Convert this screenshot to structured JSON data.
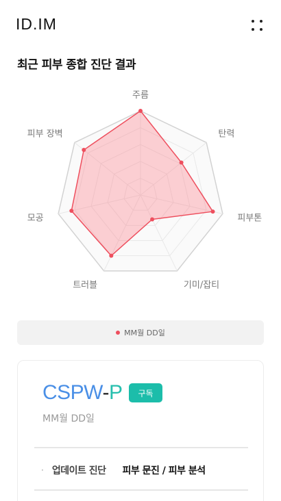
{
  "header": {
    "logo": "ID.IM"
  },
  "section": {
    "title": "최근 피부 종합 진단 결과"
  },
  "chart_data": {
    "type": "radar",
    "axes": [
      "주름",
      "탄력",
      "피부톤",
      "기미/잡티",
      "트러블",
      "모공",
      "피부 장벽"
    ],
    "max": 5,
    "levels": 5,
    "grid": true,
    "series": [
      {
        "name": "MM월 DD일",
        "values": [
          5,
          3.1,
          4.4,
          1.6,
          4.0,
          4.2,
          4.3
        ],
        "color": "#ee4f5e",
        "fill": "rgba(255, 105, 120, 0.30)"
      }
    ]
  },
  "legend": {
    "label": "MM월 DD일"
  },
  "card": {
    "product_part1": "CSPW",
    "product_part2": "-",
    "product_part3": "P",
    "badge": "구독",
    "date": "MM월 DD일",
    "rows": [
      {
        "bullet": "·",
        "label": "업데이트 진단",
        "value": "피부 문진 / 피부 분석"
      }
    ]
  },
  "colors": {
    "accent": "#1cbdaa",
    "blue": "#4a8fe6",
    "chart": "#ee4f5e"
  }
}
